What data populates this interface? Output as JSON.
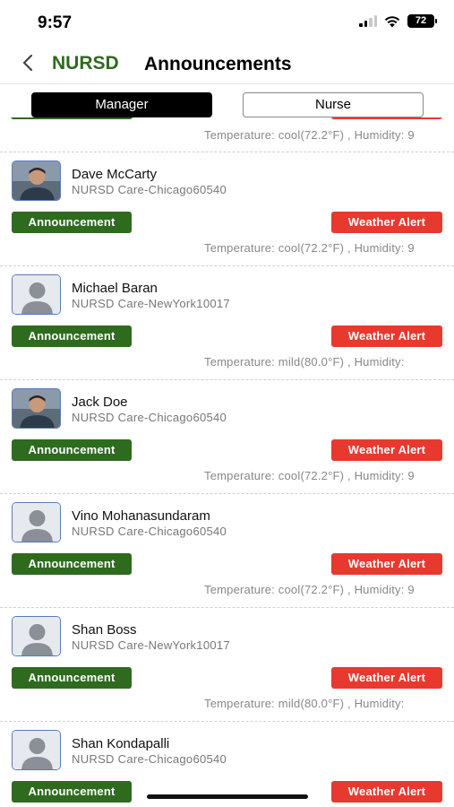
{
  "status_bar": {
    "time": "9:57",
    "battery": "72"
  },
  "header": {
    "back_icon": "chevron-left-icon",
    "logo": "NURSD",
    "title": "Announcements"
  },
  "tabs": [
    {
      "label": "Manager",
      "selected": true
    },
    {
      "label": "Nurse",
      "selected": false
    }
  ],
  "top_partial": {
    "temperature": "Temperature: cool(72.2°F) , Humidity: 9"
  },
  "colors": {
    "brand_green": "#2e6b1f",
    "alert_red": "#e8392f"
  },
  "announcements": [
    {
      "name": "Dave McCarty",
      "location": "NURSD Care-Chicago60540",
      "announcement_label": "Announcement",
      "alert_label": "Weather Alert",
      "temperature": "Temperature: cool(72.2°F) , Humidity: 9",
      "avatar": "photo"
    },
    {
      "name": "Michael Baran",
      "location": "NURSD Care-NewYork10017",
      "announcement_label": "Announcement",
      "alert_label": "Weather Alert",
      "temperature": "Temperature: mild(80.0°F) , Humidity:",
      "avatar": "placeholder"
    },
    {
      "name": "Jack Doe",
      "location": "NURSD Care-Chicago60540",
      "announcement_label": "Announcement",
      "alert_label": "Weather Alert",
      "temperature": "Temperature: cool(72.2°F) , Humidity: 9",
      "avatar": "photo"
    },
    {
      "name": "Vino Mohanasundaram",
      "location": "NURSD Care-Chicago60540",
      "announcement_label": "Announcement",
      "alert_label": "Weather Alert",
      "temperature": "Temperature: cool(72.2°F) , Humidity: 9",
      "avatar": "placeholder"
    },
    {
      "name": "Shan Boss",
      "location": "NURSD Care-NewYork10017",
      "announcement_label": "Announcement",
      "alert_label": "Weather Alert",
      "temperature": "Temperature: mild(80.0°F) , Humidity:",
      "avatar": "placeholder"
    },
    {
      "name": "Shan Kondapalli",
      "location": "NURSD Care-Chicago60540",
      "announcement_label": "Announcement",
      "alert_label": "Weather Alert",
      "temperature": "",
      "avatar": "placeholder"
    }
  ]
}
